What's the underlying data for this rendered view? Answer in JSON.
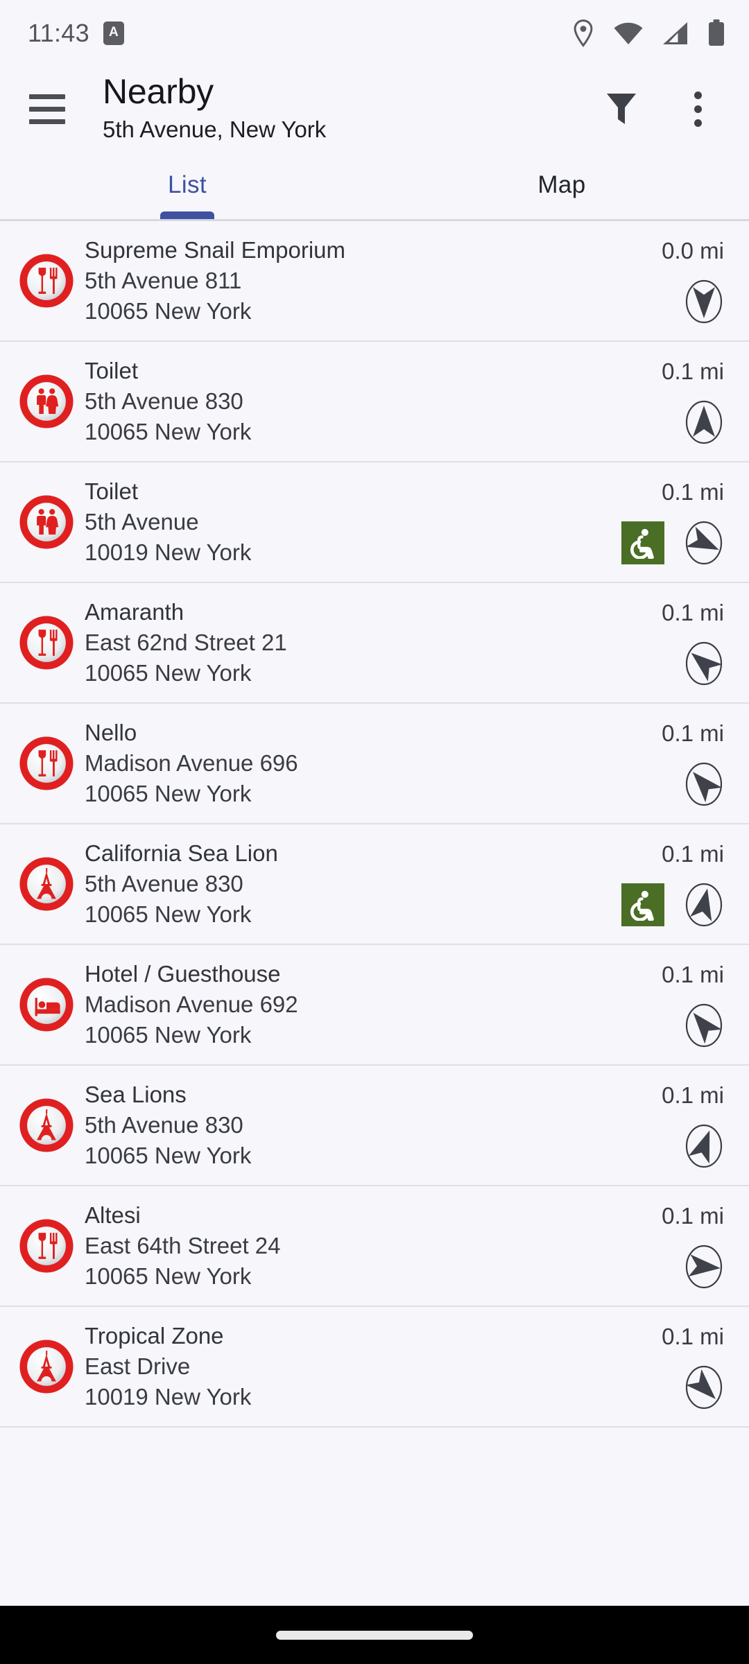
{
  "status_bar": {
    "clock": "11:43",
    "notification_badge": "A",
    "icons": [
      "location-pin-icon",
      "wifi-icon",
      "cell-signal-icon",
      "battery-icon"
    ]
  },
  "app_bar": {
    "menu_icon": "hamburger-menu-icon",
    "title": "Nearby",
    "subtitle": "5th Avenue, New York",
    "filter_icon": "filter-icon",
    "overflow_icon": "overflow-menu-icon"
  },
  "tabs": {
    "active_index": 0,
    "items": [
      {
        "label": "List"
      },
      {
        "label": "Map"
      }
    ],
    "active_color": "#3f51a0",
    "inactive_color": "#22242c"
  },
  "colors": {
    "background": "#f6f6fb",
    "accent": "#3f51a0",
    "poi_red": "#e02020",
    "accessible_green": "#4a6e25",
    "divider": "#dfe0e7"
  },
  "list": {
    "items": [
      {
        "name": "Supreme Snail Emporium",
        "street": "5th Avenue 811",
        "city": "10065 New York",
        "distance": "0.0 mi",
        "category_icon": "restaurant-icon",
        "accessible": false,
        "bearing_deg": 180
      },
      {
        "name": "Toilet",
        "street": "5th Avenue 830",
        "city": "10065 New York",
        "distance": "0.1 mi",
        "category_icon": "toilet-icon",
        "accessible": false,
        "bearing_deg": 0
      },
      {
        "name": "Toilet",
        "street": "5th Avenue",
        "city": "10019 New York",
        "distance": "0.1 mi",
        "category_icon": "toilet-icon",
        "accessible": true,
        "bearing_deg": 115
      },
      {
        "name": "Amaranth",
        "street": "East 62nd Street 21",
        "city": "10065 New York",
        "distance": "0.1 mi",
        "category_icon": "restaurant-icon",
        "accessible": false,
        "bearing_deg": 310
      },
      {
        "name": "Nello",
        "street": "Madison Avenue 696",
        "city": "10065 New York",
        "distance": "0.1 mi",
        "category_icon": "restaurant-icon",
        "accessible": false,
        "bearing_deg": 318
      },
      {
        "name": "California Sea Lion",
        "street": "5th Avenue 830",
        "city": "10065 New York",
        "distance": "0.1 mi",
        "category_icon": "attraction-icon",
        "accessible": true,
        "bearing_deg": 12
      },
      {
        "name": "Hotel / Guesthouse",
        "street": "Madison Avenue 692",
        "city": "10065 New York",
        "distance": "0.1 mi",
        "category_icon": "hotel-icon",
        "accessible": false,
        "bearing_deg": 320
      },
      {
        "name": "Sea Lions",
        "street": "5th Avenue 830",
        "city": "10065 New York",
        "distance": "0.1 mi",
        "category_icon": "attraction-icon",
        "accessible": false,
        "bearing_deg": 20
      },
      {
        "name": "Altesi",
        "street": "East 64th Street 24",
        "city": "10065 New York",
        "distance": "0.1 mi",
        "category_icon": "restaurant-icon",
        "accessible": false,
        "bearing_deg": 95
      },
      {
        "name": "Tropical Zone",
        "street": "East Drive",
        "city": "10019 New York",
        "distance": "0.1 mi",
        "category_icon": "attraction-icon",
        "accessible": false,
        "bearing_deg": 135
      }
    ]
  },
  "nav_bar": {
    "gesture_pill": "home-gesture-pill"
  }
}
